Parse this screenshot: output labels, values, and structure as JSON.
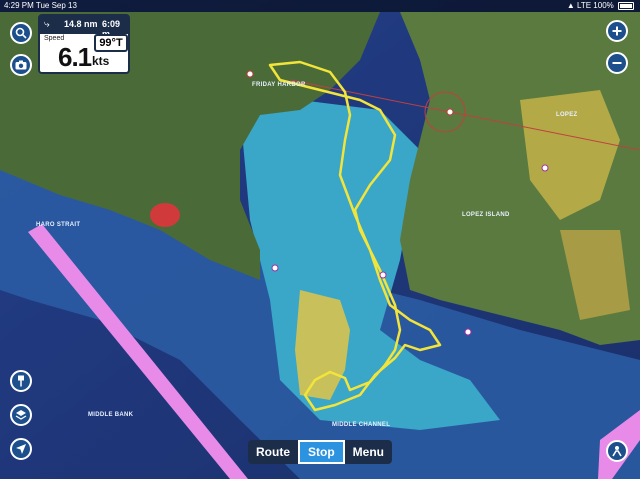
{
  "status_bar": {
    "time": "4:29 PM",
    "date": "Tue Sep 13",
    "carrier": "LTE",
    "battery": "100%"
  },
  "instruments": {
    "distance": "14.8 nm",
    "eta": "6:09 m",
    "speed_label": "Speed",
    "speed_value": "6.1",
    "speed_unit": "kts",
    "heading": "99°T"
  },
  "bottom_bar": {
    "route_label": "Route",
    "stop_label": "Stop",
    "menu_label": "Menu"
  },
  "map_labels": {
    "haro_strait": "HARO STRAIT",
    "middle_bank": "MIDDLE BANK",
    "middle_channel": "MIDDLE CHANNEL",
    "lopez": "LOPEZ",
    "lopez_island": "LOPEZ ISLAND",
    "friday_harbor": "FRIDAY HARBOR"
  },
  "icons": {
    "search": "magnifier-icon",
    "camera": "camera-icon",
    "zoom_in": "plus-icon",
    "zoom_out": "minus-icon",
    "pin": "pin-icon",
    "layers": "layers-icon",
    "locate": "navigation-arrow-icon",
    "person": "person-icon"
  },
  "colors": {
    "track": "#f2e43a",
    "deep_water": "#1d3a7a",
    "shallow_water": "#3aa6c8",
    "land": "#4b6b3a",
    "boundary": "#e88be8",
    "accent": "#2c93e0"
  }
}
